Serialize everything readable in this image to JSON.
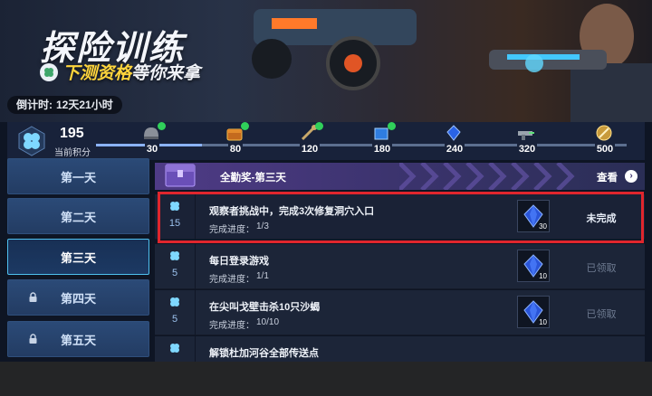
{
  "banner": {
    "title": "探险训练",
    "subtitle_pre": "下测资格",
    "subtitle_post": "等你来拿",
    "countdown_label": "倒计时:",
    "countdown_value": "12天21小时"
  },
  "score": {
    "value": "195",
    "label": "当前积分"
  },
  "progress": {
    "fill_fraction": 0.2,
    "milestones": [
      {
        "value": "30",
        "icon": "helmet-icon",
        "claimed": true
      },
      {
        "value": "80",
        "icon": "chest-icon",
        "claimed": true
      },
      {
        "value": "120",
        "icon": "wrench-icon",
        "claimed": true
      },
      {
        "value": "180",
        "icon": "blue-box-icon",
        "claimed": true
      },
      {
        "value": "240",
        "icon": "blue-gem-icon",
        "claimed": false
      },
      {
        "value": "320",
        "icon": "gun-icon",
        "claimed": false
      },
      {
        "value": "500",
        "icon": "gold-emblem-icon",
        "claimed": false
      }
    ]
  },
  "days": [
    {
      "label": "第一天",
      "locked": false,
      "active": false
    },
    {
      "label": "第二天",
      "locked": false,
      "active": false
    },
    {
      "label": "第三天",
      "locked": false,
      "active": true
    },
    {
      "label": "第四天",
      "locked": true,
      "active": false
    },
    {
      "label": "第五天",
      "locked": true,
      "active": false
    }
  ],
  "award": {
    "title": "全勤奖-第三天",
    "view": "查看"
  },
  "tasks": [
    {
      "points": "15",
      "title": "观察者挑战中，完成3次修复洞穴入口",
      "progress_label": "完成进度：",
      "progress_value": "1/3",
      "reward_count": "30",
      "status": "未完成",
      "done": false
    },
    {
      "points": "5",
      "title": "每日登录游戏",
      "progress_label": "完成进度：",
      "progress_value": "1/1",
      "reward_count": "10",
      "status": "已领取",
      "done": true
    },
    {
      "points": "5",
      "title": "在尖叫戈壁击杀10只沙蝎",
      "progress_label": "完成进度：",
      "progress_value": "10/10",
      "reward_count": "10",
      "status": "已领取",
      "done": true
    },
    {
      "points": "",
      "title": "解锁杜加河谷全部传送点",
      "progress_label": "",
      "progress_value": "",
      "reward_count": "",
      "status": "",
      "done": true
    }
  ],
  "colors": {
    "accent": "#4fc0ee",
    "highlight": "#e0262d",
    "claimed": "#30d05a",
    "gold": "#ffd53c"
  }
}
